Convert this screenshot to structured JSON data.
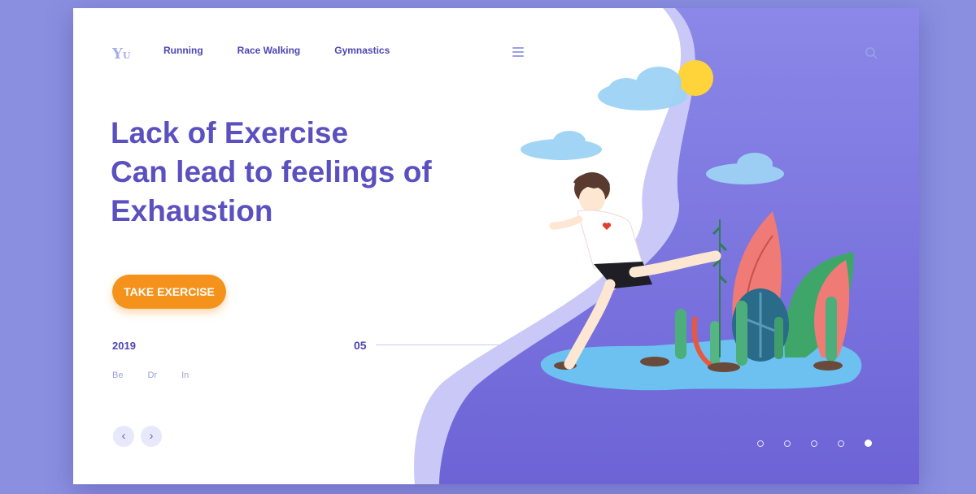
{
  "brand": {
    "logo_text": "Y",
    "logo_sub": "U"
  },
  "nav": {
    "items": [
      "Running",
      "Race Walking",
      "Gymnastics"
    ]
  },
  "hero": {
    "headline_lines": [
      "Lack of Exercise",
      "Can lead to feelings of",
      "Exhaustion"
    ],
    "cta_label": "TAKE EXERCISE"
  },
  "meta": {
    "year": "2019",
    "slide_number": "05"
  },
  "social": {
    "items": [
      "Be",
      "Dr",
      "In"
    ]
  },
  "pager": {
    "prev": "‹",
    "next": "›",
    "dot_count": 5,
    "active_index": 4
  },
  "colors": {
    "accent": "#f5921c",
    "primary_text": "#5a50bf",
    "panel_purple": "#7a72dc",
    "page_background": "#8a8fe0"
  },
  "icons": [
    "menu-icon",
    "search-icon",
    "chevron-left-icon",
    "chevron-right-icon"
  ]
}
